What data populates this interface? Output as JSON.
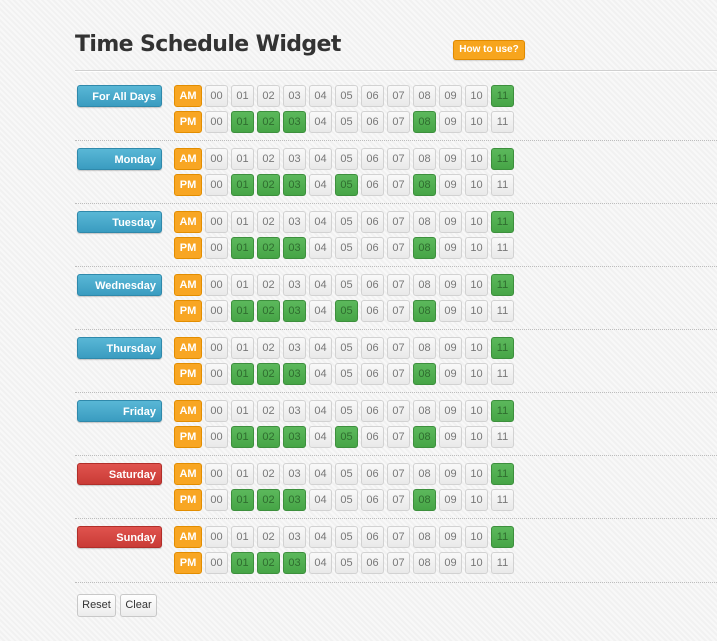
{
  "title": "Time Schedule Widget",
  "how_to_use": "How to use?",
  "am_label": "AM",
  "pm_label": "PM",
  "hours": [
    "00",
    "01",
    "02",
    "03",
    "04",
    "05",
    "06",
    "07",
    "08",
    "09",
    "10",
    "11"
  ],
  "colors": {
    "day_blue": "#3a9cc0",
    "day_red": "#c93b36",
    "am_pm": "#f8a623",
    "selected": "#5cb85c",
    "unselected": "#efefef"
  },
  "days": [
    {
      "label": "For All Days",
      "color": "blue",
      "am_selected": [
        "11"
      ],
      "pm_selected": [
        "01",
        "02",
        "03",
        "08"
      ]
    },
    {
      "label": "Monday",
      "color": "blue",
      "am_selected": [
        "11"
      ],
      "pm_selected": [
        "01",
        "02",
        "03",
        "05",
        "08"
      ]
    },
    {
      "label": "Tuesday",
      "color": "blue",
      "am_selected": [
        "11"
      ],
      "pm_selected": [
        "01",
        "02",
        "03",
        "08"
      ]
    },
    {
      "label": "Wednesday",
      "color": "blue",
      "am_selected": [
        "11"
      ],
      "pm_selected": [
        "01",
        "02",
        "03",
        "05",
        "08"
      ]
    },
    {
      "label": "Thursday",
      "color": "blue",
      "am_selected": [
        "11"
      ],
      "pm_selected": [
        "01",
        "02",
        "03",
        "08"
      ]
    },
    {
      "label": "Friday",
      "color": "blue",
      "am_selected": [
        "11"
      ],
      "pm_selected": [
        "01",
        "02",
        "03",
        "05",
        "08"
      ]
    },
    {
      "label": "Saturday",
      "color": "red",
      "am_selected": [
        "11"
      ],
      "pm_selected": [
        "01",
        "02",
        "03",
        "08"
      ]
    },
    {
      "label": "Sunday",
      "color": "red",
      "am_selected": [
        "11"
      ],
      "pm_selected": [
        "01",
        "02",
        "03"
      ]
    }
  ],
  "footer": {
    "reset_label": "Reset",
    "clear_label": "Clear"
  }
}
